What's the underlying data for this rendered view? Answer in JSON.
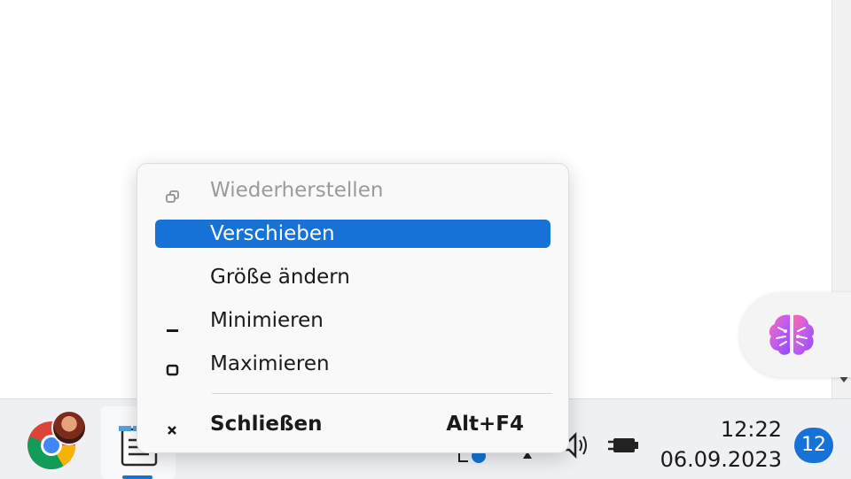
{
  "menu": {
    "items": [
      {
        "label": "Wiederherstellen",
        "icon": "restore-icon",
        "state": "disabled"
      },
      {
        "label": "Verschieben",
        "icon": "",
        "state": "selected"
      },
      {
        "label": "Größe ändern",
        "icon": "",
        "state": "normal"
      },
      {
        "label": "Minimieren",
        "icon": "minimize-icon",
        "state": "normal"
      },
      {
        "label": "Maximieren",
        "icon": "maximize-icon",
        "state": "normal"
      },
      {
        "label": "Schließen",
        "icon": "close-icon",
        "state": "normal",
        "shortcut": "Alt+F4"
      }
    ]
  },
  "taskbar": {
    "clock_time": "12:22",
    "clock_date": "06.09.2023",
    "notification_count": "12",
    "apps": [
      "chrome-icon",
      "notepad-icon"
    ],
    "tray": [
      "network-icon",
      "overflow-icon",
      "volume-icon",
      "battery-icon"
    ]
  },
  "colors": {
    "accent": "#1672d6",
    "menu_bg": "#f9f9f9",
    "taskbar_bg": "#eef0f4"
  }
}
